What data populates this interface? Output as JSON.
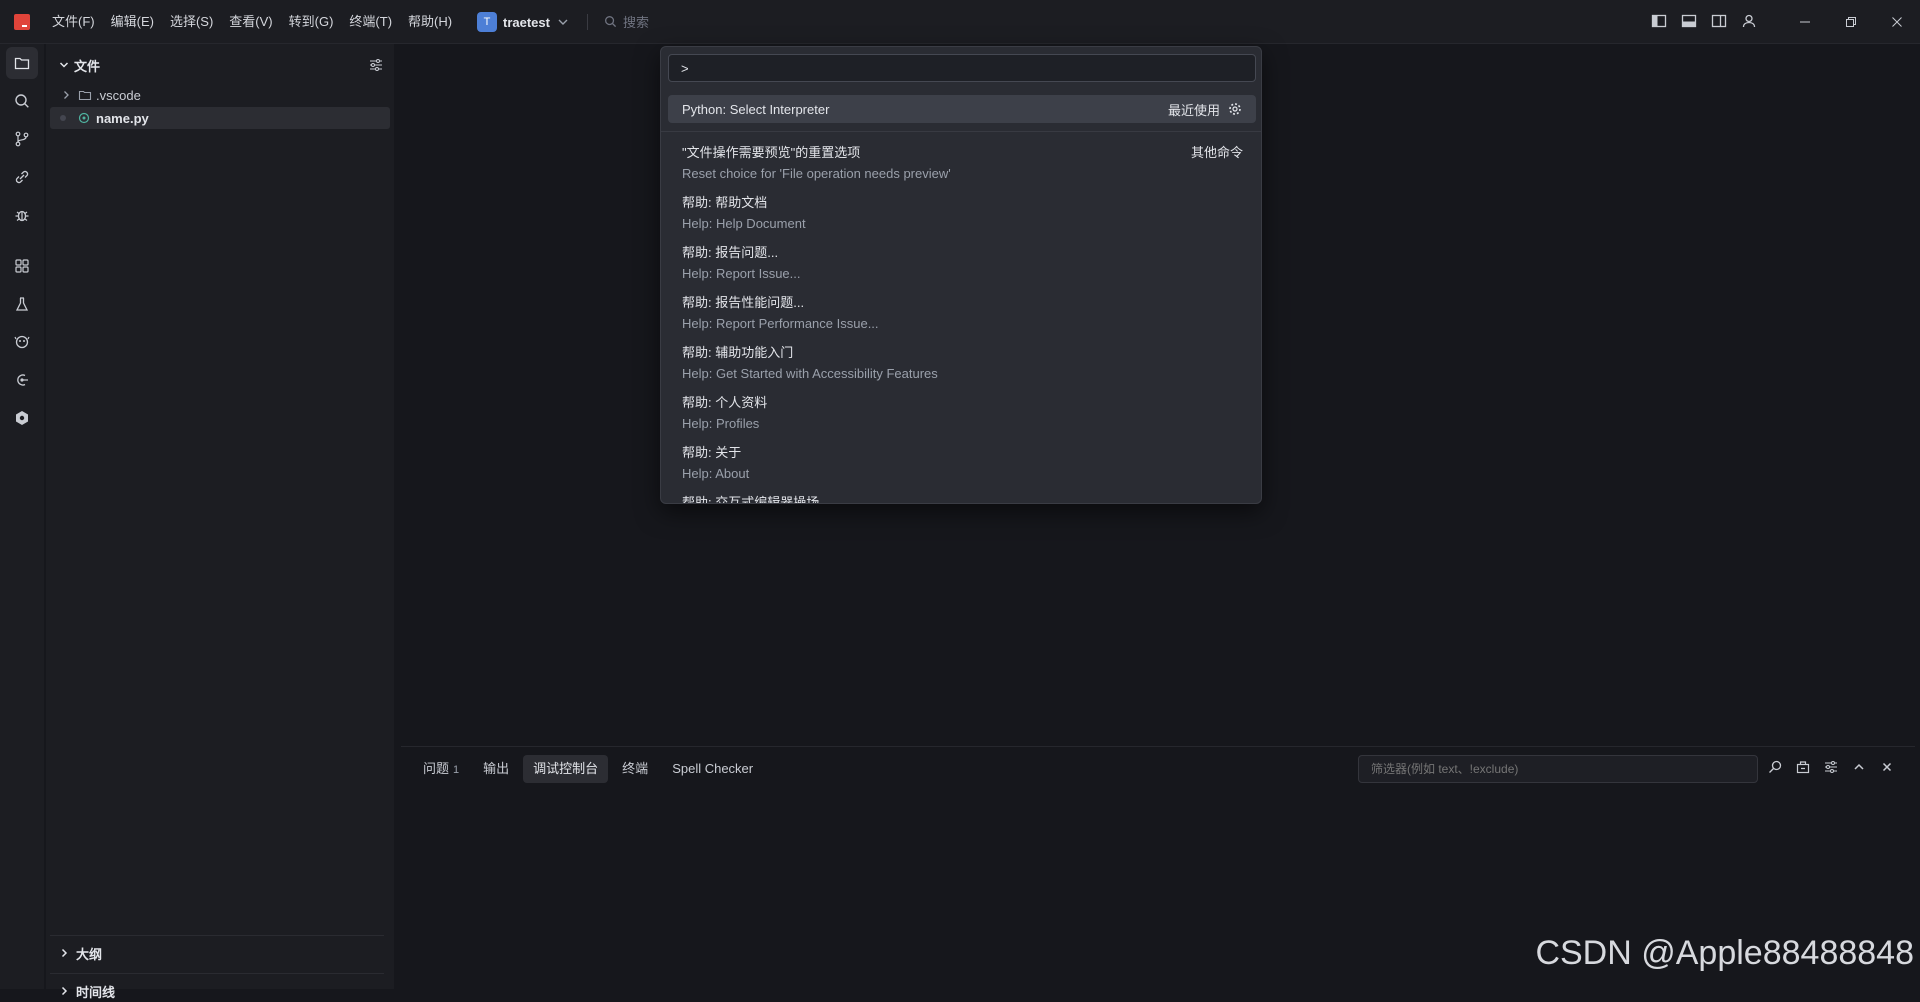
{
  "menu": [
    "文件(F)",
    "编辑(E)",
    "选择(S)",
    "查看(V)",
    "转到(G)",
    "终端(T)",
    "帮助(H)"
  ],
  "project": {
    "avatar": "T",
    "name": "traetest"
  },
  "top_search": {
    "placeholder": "搜索"
  },
  "sidebar": {
    "title": "文件",
    "tree": [
      {
        "label": ".vscode",
        "type": "folder"
      },
      {
        "label": "name.py",
        "type": "file"
      }
    ],
    "outline": "大纲",
    "timeline": "时间线"
  },
  "palette": {
    "input": ">",
    "highlighted": {
      "label": "Python: Select Interpreter",
      "tag": "最近使用"
    },
    "group": "其他命令",
    "items": [
      {
        "label": "\"文件操作需要预览\"的重置选项",
        "sub": "Reset choice for 'File operation needs preview'"
      },
      {
        "label": "帮助: 帮助文档",
        "sub": "Help: Help Document"
      },
      {
        "label": "帮助: 报告问题...",
        "sub": "Help: Report Issue..."
      },
      {
        "label": "帮助: 报告性能问题...",
        "sub": "Help: Report Performance Issue..."
      },
      {
        "label": "帮助: 辅助功能入门",
        "sub": "Help: Get Started with Accessibility Features"
      },
      {
        "label": "帮助: 个人资料",
        "sub": "Help: Profiles"
      },
      {
        "label": "帮助: 关于",
        "sub": "Help: About"
      },
      {
        "label": "帮助: 交互式编辑器操场",
        "sub": ""
      }
    ]
  },
  "panel": {
    "tabs": [
      {
        "label": "问题",
        "badge": "1"
      },
      {
        "label": "输出",
        "badge": ""
      },
      {
        "label": "调试控制台",
        "badge": ""
      },
      {
        "label": "终端",
        "badge": ""
      },
      {
        "label": "Spell Checker",
        "badge": ""
      }
    ],
    "filter_placeholder": "筛选器(例如 text、!exclude)"
  },
  "watermark": "CSDN @Apple88488848"
}
